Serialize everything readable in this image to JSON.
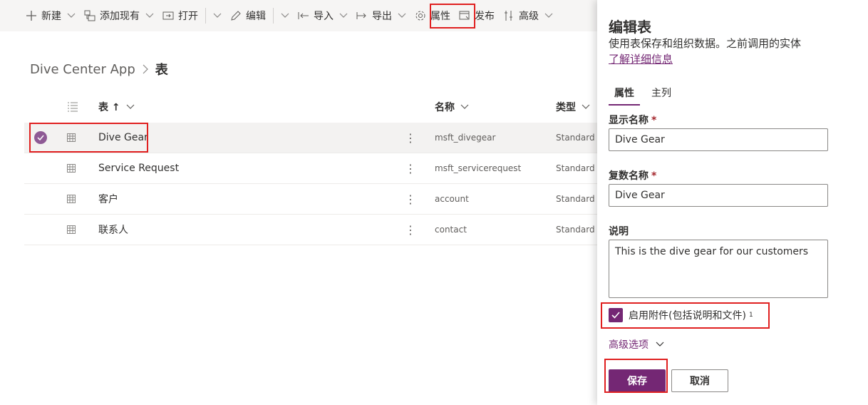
{
  "toolbar": {
    "new_label": "新建",
    "add_existing_label": "添加现有",
    "open_label": "打开",
    "edit_label": "编辑",
    "import_label": "导入",
    "export_label": "导出",
    "properties_label": "属性",
    "publish_label": "发布",
    "advanced_label": "高级"
  },
  "breadcrumb": {
    "app": "Dive Center App",
    "current": "表"
  },
  "grid": {
    "headers": {
      "table": "表 ↑",
      "name": "名称",
      "type": "类型"
    },
    "rows": [
      {
        "table": "Dive Gear",
        "name": "msft_divegear",
        "type": "Standard",
        "selected": true
      },
      {
        "table": "Service Request",
        "name": "msft_servicerequest",
        "type": "Standard",
        "selected": false
      },
      {
        "table": "客户",
        "name": "account",
        "type": "Standard",
        "selected": false
      },
      {
        "table": "联系人",
        "name": "contact",
        "type": "Standard",
        "selected": false
      }
    ]
  },
  "panel": {
    "title": "编辑表",
    "description": "使用表保存和组织数据。之前调用的实体",
    "learn_more": "了解详细信息",
    "tabs": [
      "属性",
      "主列"
    ],
    "display_name_label": "显示名称",
    "display_name_value": "Dive Gear",
    "plural_name_label": "复数名称",
    "plural_name_value": "Dive Gear",
    "required_mark": "*",
    "description_label": "说明",
    "description_value": "This is the dive gear for our customers",
    "attachments_label": "启用附件(包括说明和文件)",
    "attachments_footnote": "1",
    "attachments_checked": true,
    "advanced_options": "高级选项",
    "save_label": "保存",
    "cancel_label": "取消"
  },
  "colors": {
    "accent": "#742774",
    "highlight": "#e02020",
    "toolbar_bg": "#f6f5f4",
    "selected_row": "#f3f2f1"
  }
}
